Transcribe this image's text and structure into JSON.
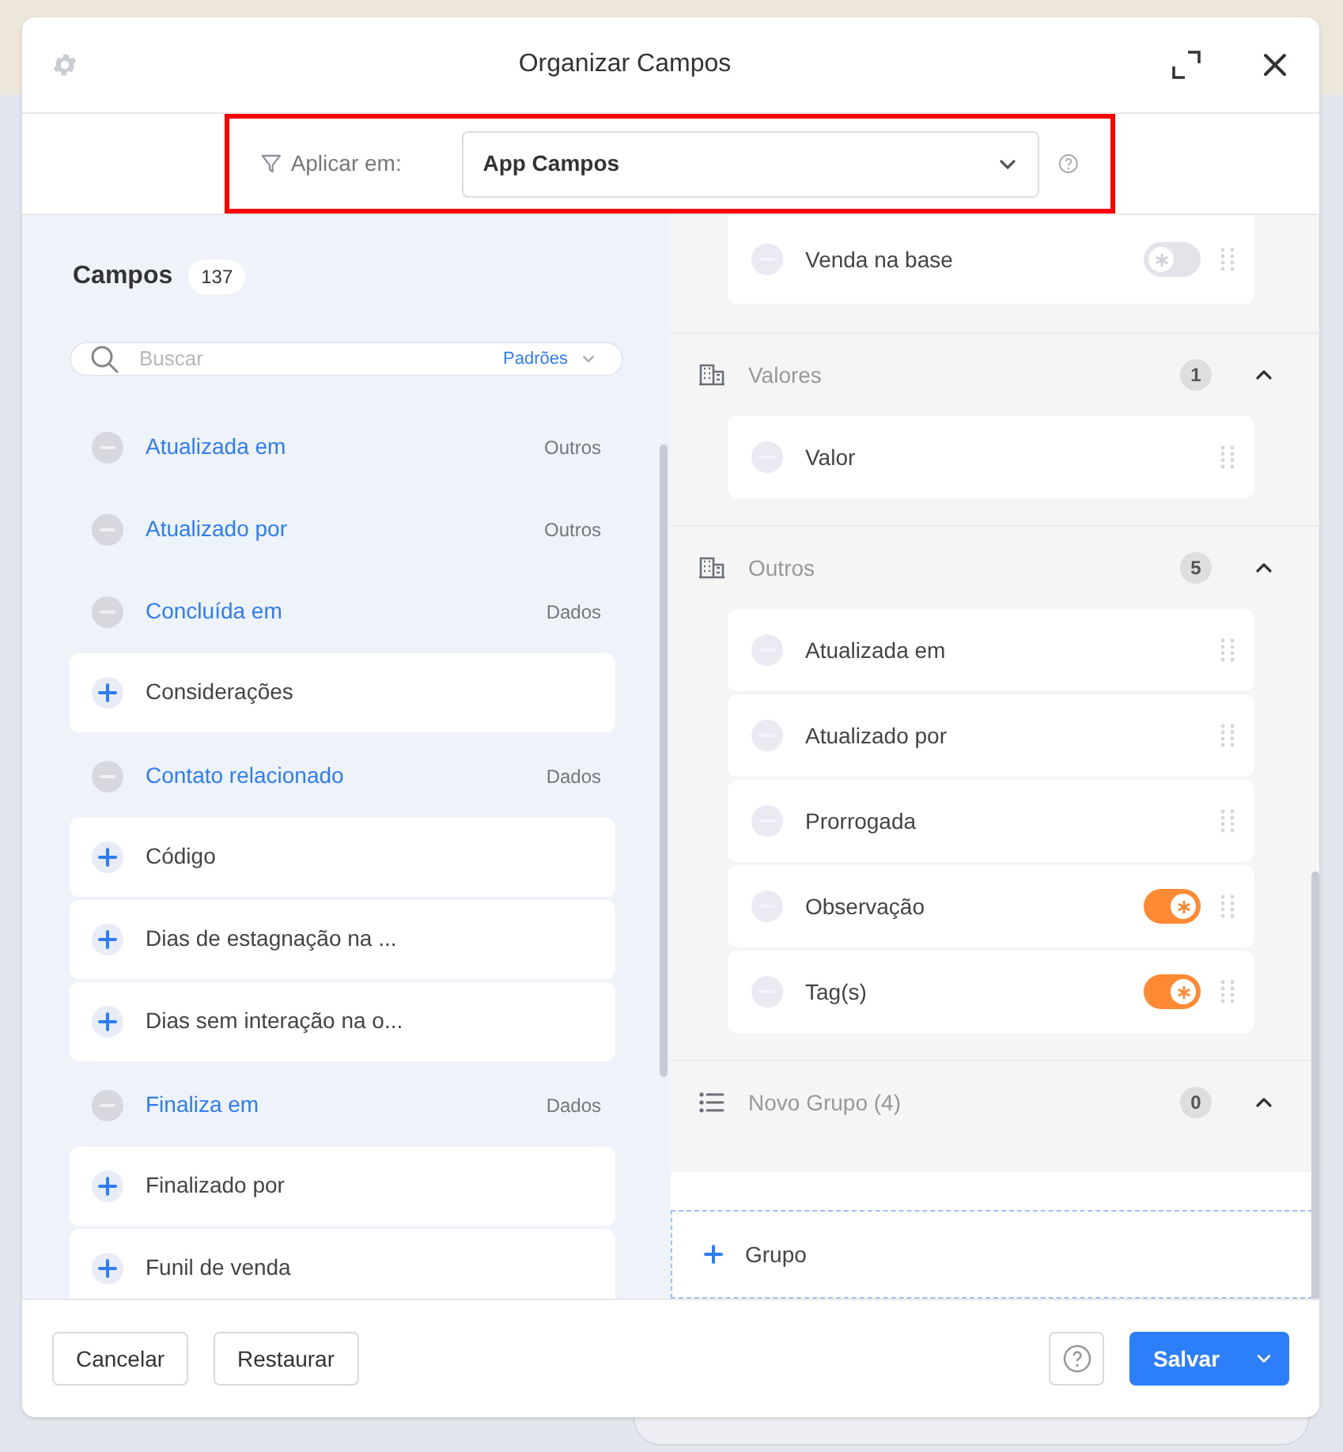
{
  "dialog": {
    "title": "Organizar Campos"
  },
  "filter": {
    "label": "Aplicar em:",
    "value": "App Campos",
    "highlighted": true
  },
  "fields_panel": {
    "title": "Campos",
    "count": "137",
    "search": {
      "placeholder": "Buscar",
      "filter": "Padrões"
    },
    "items": [
      {
        "label": "Atualizada em",
        "kind": "added",
        "category": "Outros"
      },
      {
        "label": "Atualizado por",
        "kind": "added",
        "category": "Outros"
      },
      {
        "label": "Concluída em",
        "kind": "added",
        "category": "Dados"
      },
      {
        "label": "Considerações",
        "kind": "available"
      },
      {
        "label": "Contato relacionado",
        "kind": "added",
        "category": "Dados"
      },
      {
        "label": "Código",
        "kind": "available"
      },
      {
        "label": "Dias de estagnação na ...",
        "kind": "available"
      },
      {
        "label": "Dias sem interação na o...",
        "kind": "available"
      },
      {
        "label": "Finaliza em",
        "kind": "added",
        "category": "Dados"
      },
      {
        "label": "Finalizado por",
        "kind": "available"
      },
      {
        "label": "Funil de venda",
        "kind": "available"
      }
    ]
  },
  "groups": [
    {
      "fields": [
        {
          "label": "Venda na base",
          "required": false
        }
      ]
    },
    {
      "title": "Valores",
      "kind": "standard",
      "count": "1",
      "expanded": true,
      "fields": [
        {
          "label": "Valor"
        }
      ]
    },
    {
      "title": "Outros",
      "kind": "standard",
      "count": "5",
      "expanded": true,
      "fields": [
        {
          "label": "Atualizada em"
        },
        {
          "label": "Atualizado por"
        },
        {
          "label": "Prorrogada"
        },
        {
          "label": "Observação",
          "required": true
        },
        {
          "label": "Tag(s)",
          "required": true
        }
      ]
    },
    {
      "title": "Novo Grupo (4)",
      "kind": "custom",
      "count": "0",
      "expanded": true
    }
  ],
  "add_group": "Grupo",
  "footer": {
    "cancel": "Cancelar",
    "restore": "Restaurar",
    "save": "Salvar"
  }
}
